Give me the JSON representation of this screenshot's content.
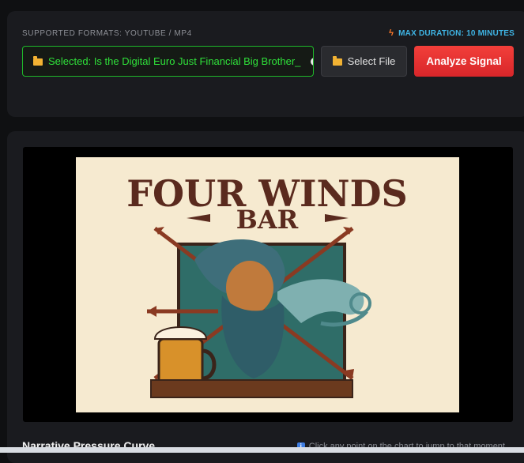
{
  "upload": {
    "formats_label": "SUPPORTED FORMATS: YOUTUBE / MP4",
    "max_duration_label": "MAX DURATION: 10 MINUTES",
    "selected_text": "Selected: Is the Digital Euro Just Financial Big Brother_",
    "select_file_label": "Select File",
    "analyze_label": "Analyze Signal"
  },
  "video": {
    "poster_title_line1": "FOUR WINDS",
    "poster_title_line2": "BAR"
  },
  "curve": {
    "title": "Narrative Pressure Curve",
    "hint": "Click any point on the chart to jump to that moment"
  },
  "colors": {
    "selected_green": "#2fe03a",
    "analyze_red": "#e53232",
    "accent_blue": "#3fb5e5",
    "poster_brown": "#5a2a1e"
  },
  "icons": [
    "lightning-icon",
    "folder-icon",
    "eye-icon",
    "info-icon"
  ]
}
